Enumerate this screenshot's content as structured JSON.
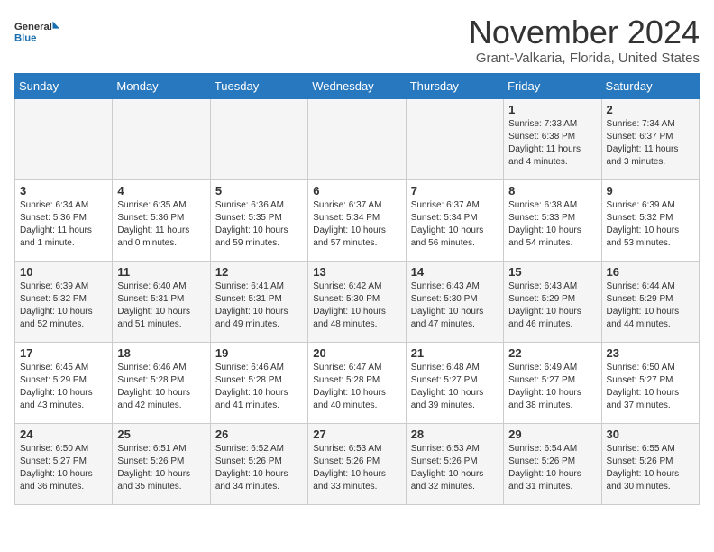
{
  "logo": {
    "line1": "General",
    "line2": "Blue"
  },
  "title": "November 2024",
  "subtitle": "Grant-Valkaria, Florida, United States",
  "weekdays": [
    "Sunday",
    "Monday",
    "Tuesday",
    "Wednesday",
    "Thursday",
    "Friday",
    "Saturday"
  ],
  "weeks": [
    [
      {
        "day": "",
        "info": ""
      },
      {
        "day": "",
        "info": ""
      },
      {
        "day": "",
        "info": ""
      },
      {
        "day": "",
        "info": ""
      },
      {
        "day": "",
        "info": ""
      },
      {
        "day": "1",
        "info": "Sunrise: 7:33 AM\nSunset: 6:38 PM\nDaylight: 11 hours\nand 4 minutes."
      },
      {
        "day": "2",
        "info": "Sunrise: 7:34 AM\nSunset: 6:37 PM\nDaylight: 11 hours\nand 3 minutes."
      }
    ],
    [
      {
        "day": "3",
        "info": "Sunrise: 6:34 AM\nSunset: 5:36 PM\nDaylight: 11 hours\nand 1 minute."
      },
      {
        "day": "4",
        "info": "Sunrise: 6:35 AM\nSunset: 5:36 PM\nDaylight: 11 hours\nand 0 minutes."
      },
      {
        "day": "5",
        "info": "Sunrise: 6:36 AM\nSunset: 5:35 PM\nDaylight: 10 hours\nand 59 minutes."
      },
      {
        "day": "6",
        "info": "Sunrise: 6:37 AM\nSunset: 5:34 PM\nDaylight: 10 hours\nand 57 minutes."
      },
      {
        "day": "7",
        "info": "Sunrise: 6:37 AM\nSunset: 5:34 PM\nDaylight: 10 hours\nand 56 minutes."
      },
      {
        "day": "8",
        "info": "Sunrise: 6:38 AM\nSunset: 5:33 PM\nDaylight: 10 hours\nand 54 minutes."
      },
      {
        "day": "9",
        "info": "Sunrise: 6:39 AM\nSunset: 5:32 PM\nDaylight: 10 hours\nand 53 minutes."
      }
    ],
    [
      {
        "day": "10",
        "info": "Sunrise: 6:39 AM\nSunset: 5:32 PM\nDaylight: 10 hours\nand 52 minutes."
      },
      {
        "day": "11",
        "info": "Sunrise: 6:40 AM\nSunset: 5:31 PM\nDaylight: 10 hours\nand 51 minutes."
      },
      {
        "day": "12",
        "info": "Sunrise: 6:41 AM\nSunset: 5:31 PM\nDaylight: 10 hours\nand 49 minutes."
      },
      {
        "day": "13",
        "info": "Sunrise: 6:42 AM\nSunset: 5:30 PM\nDaylight: 10 hours\nand 48 minutes."
      },
      {
        "day": "14",
        "info": "Sunrise: 6:43 AM\nSunset: 5:30 PM\nDaylight: 10 hours\nand 47 minutes."
      },
      {
        "day": "15",
        "info": "Sunrise: 6:43 AM\nSunset: 5:29 PM\nDaylight: 10 hours\nand 46 minutes."
      },
      {
        "day": "16",
        "info": "Sunrise: 6:44 AM\nSunset: 5:29 PM\nDaylight: 10 hours\nand 44 minutes."
      }
    ],
    [
      {
        "day": "17",
        "info": "Sunrise: 6:45 AM\nSunset: 5:29 PM\nDaylight: 10 hours\nand 43 minutes."
      },
      {
        "day": "18",
        "info": "Sunrise: 6:46 AM\nSunset: 5:28 PM\nDaylight: 10 hours\nand 42 minutes."
      },
      {
        "day": "19",
        "info": "Sunrise: 6:46 AM\nSunset: 5:28 PM\nDaylight: 10 hours\nand 41 minutes."
      },
      {
        "day": "20",
        "info": "Sunrise: 6:47 AM\nSunset: 5:28 PM\nDaylight: 10 hours\nand 40 minutes."
      },
      {
        "day": "21",
        "info": "Sunrise: 6:48 AM\nSunset: 5:27 PM\nDaylight: 10 hours\nand 39 minutes."
      },
      {
        "day": "22",
        "info": "Sunrise: 6:49 AM\nSunset: 5:27 PM\nDaylight: 10 hours\nand 38 minutes."
      },
      {
        "day": "23",
        "info": "Sunrise: 6:50 AM\nSunset: 5:27 PM\nDaylight: 10 hours\nand 37 minutes."
      }
    ],
    [
      {
        "day": "24",
        "info": "Sunrise: 6:50 AM\nSunset: 5:27 PM\nDaylight: 10 hours\nand 36 minutes."
      },
      {
        "day": "25",
        "info": "Sunrise: 6:51 AM\nSunset: 5:26 PM\nDaylight: 10 hours\nand 35 minutes."
      },
      {
        "day": "26",
        "info": "Sunrise: 6:52 AM\nSunset: 5:26 PM\nDaylight: 10 hours\nand 34 minutes."
      },
      {
        "day": "27",
        "info": "Sunrise: 6:53 AM\nSunset: 5:26 PM\nDaylight: 10 hours\nand 33 minutes."
      },
      {
        "day": "28",
        "info": "Sunrise: 6:53 AM\nSunset: 5:26 PM\nDaylight: 10 hours\nand 32 minutes."
      },
      {
        "day": "29",
        "info": "Sunrise: 6:54 AM\nSunset: 5:26 PM\nDaylight: 10 hours\nand 31 minutes."
      },
      {
        "day": "30",
        "info": "Sunrise: 6:55 AM\nSunset: 5:26 PM\nDaylight: 10 hours\nand 30 minutes."
      }
    ]
  ]
}
